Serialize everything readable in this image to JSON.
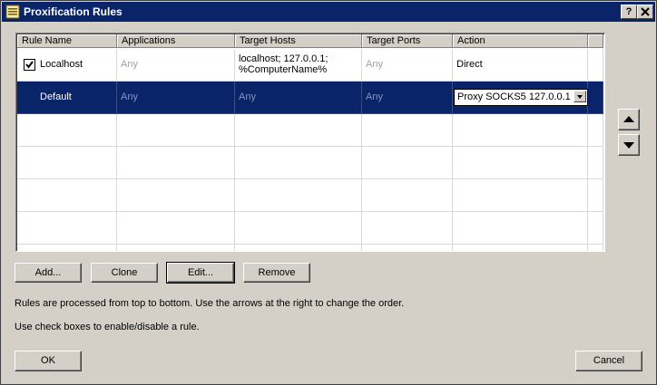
{
  "window": {
    "title": "Proxification Rules",
    "help_label": "?",
    "close_label": "X"
  },
  "table": {
    "columns": [
      "Rule Name",
      "Applications",
      "Target Hosts",
      "Target Ports",
      "Action"
    ],
    "rows": [
      {
        "name": "Localhost",
        "checked": true,
        "applications": "Any",
        "hosts_line1": "localhost; 127.0.0.1;",
        "hosts_line2": "%ComputerName%",
        "ports": "Any",
        "action": "Direct"
      },
      {
        "name": "Default",
        "applications": "Any",
        "hosts": "Any",
        "ports": "Any",
        "action": "Proxy SOCKS5 127.0.0.1"
      }
    ]
  },
  "buttons": {
    "add": "Add...",
    "clone": "Clone",
    "edit": "Edit...",
    "remove": "Remove",
    "ok": "OK",
    "cancel": "Cancel"
  },
  "info": {
    "line1": "Rules are processed from top to bottom. Use the arrows at the right to change the order.",
    "line2": "Use check boxes to enable/disable a rule."
  }
}
